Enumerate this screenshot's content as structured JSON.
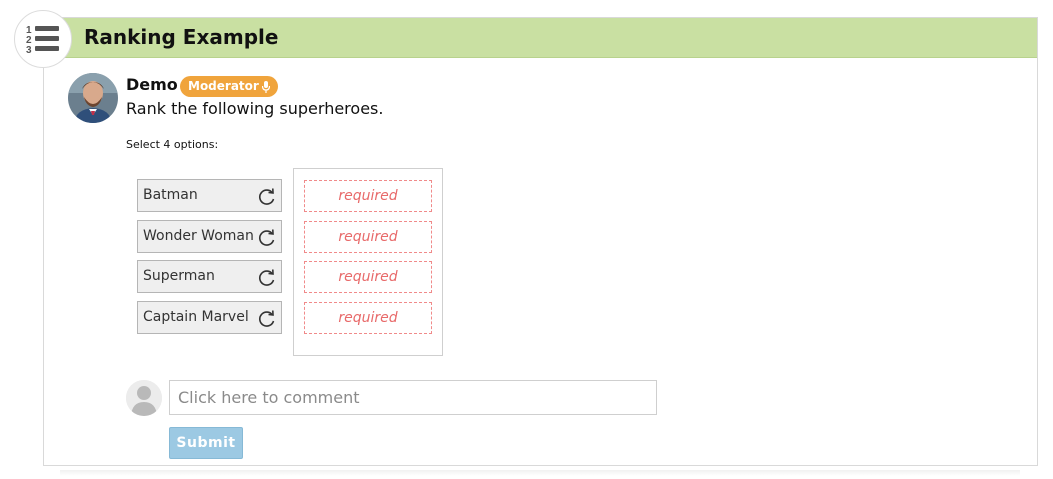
{
  "card": {
    "title": "Ranking Example"
  },
  "post": {
    "author": "Demo",
    "role": "Moderator",
    "question": "Rank the following superheroes.",
    "select_note": "Select 4 options:"
  },
  "options": [
    {
      "label": "Batman"
    },
    {
      "label": "Wonder Woman"
    },
    {
      "label": "Superman"
    },
    {
      "label": "Captain Marvel"
    }
  ],
  "slots": [
    {
      "label": "required"
    },
    {
      "label": "required"
    },
    {
      "label": "required"
    },
    {
      "label": "required"
    }
  ],
  "comment": {
    "placeholder": "Click here to comment",
    "submit_label": "Submit"
  },
  "icons": {
    "type_badge": "numbered-list-icon",
    "role": "microphone-icon",
    "option_action": "rotate-icon"
  },
  "colors": {
    "header": "#c9e0a2",
    "badge": "#f0a43c",
    "required": "#e86a6a",
    "submit": "#9cc9e3"
  }
}
